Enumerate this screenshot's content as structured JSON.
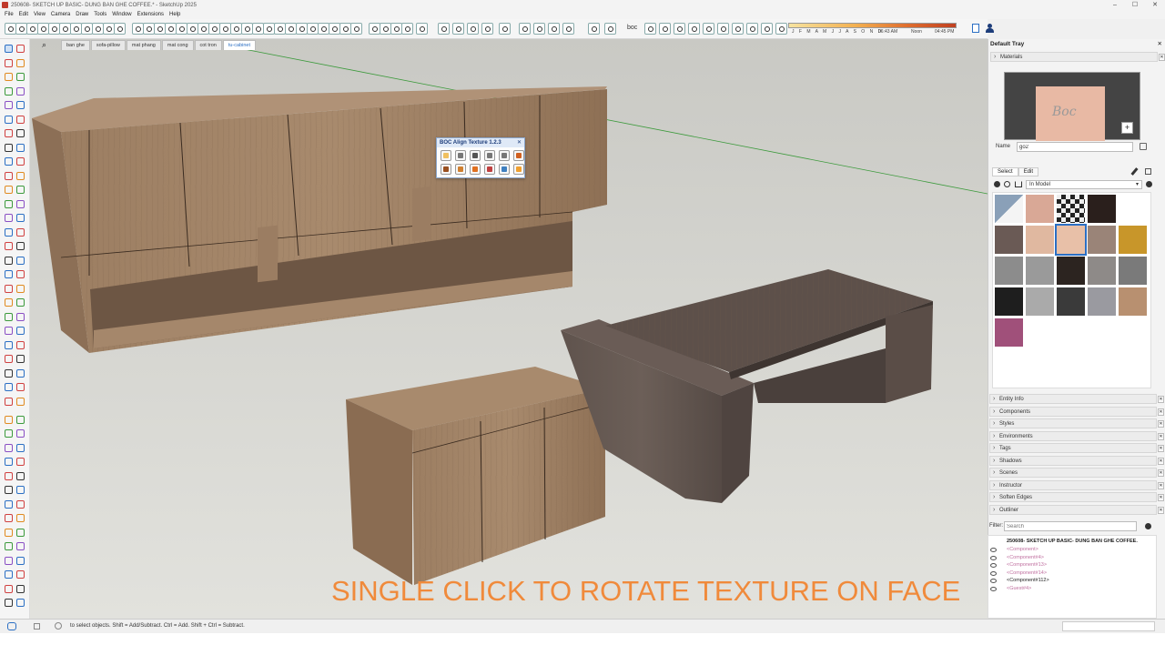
{
  "window": {
    "title": "250608- SKETCH UP BASIC- DUNG BAN GHE COFFEE.* - SketchUp 2025",
    "controls": [
      "–",
      "☐",
      "✕"
    ]
  },
  "menu": [
    "File",
    "Edit",
    "View",
    "Camera",
    "Draw",
    "Tools",
    "Window",
    "Extensions",
    "Help"
  ],
  "toolbar": {
    "boc_label": "boc",
    "shadow_months": "J F M A M J J A S O N D",
    "time_start": "06:43 AM",
    "time_mid": "Noon",
    "time_end": "04:45 PM"
  },
  "scene_tabs": [
    "ban ghe",
    "sofa-pillow",
    "mat phang",
    "mat cong",
    "cot tron",
    "tu-cabinet"
  ],
  "active_scene": "tu-cabinet",
  "overlay_caption": "SINGLE CLICK TO ROTATE TEXTURE ON FACE",
  "plugin_dialog": {
    "title": "BOC Align Texture 1.2.3",
    "close": "✕"
  },
  "tray": {
    "title": "Default Tray",
    "close": "✕",
    "materials": {
      "title": "Materials",
      "preview_text": "Boc",
      "name_label": "Name",
      "name_value": "go2",
      "tab_select": "Select",
      "tab_edit": "Edit",
      "collection": "In Model"
    },
    "panels": [
      "Entity Info",
      "Components",
      "Styles",
      "Environments",
      "Tags",
      "Shadows",
      "Scenes",
      "Instructor",
      "Soften Edges",
      "Outliner"
    ],
    "outliner": {
      "filter_label": "Filter:",
      "filter_placeholder": "Search",
      "root": "250608- SKETCH UP BASIC- DUNG BAN GHE COFFEE.",
      "rows": [
        "<Component>",
        "<Component#4>",
        "<Component#13>",
        "<Component#14>",
        "<Component#112>",
        "<Guest#4>"
      ]
    },
    "colors": {
      "accent": "#2b6fc4",
      "caption": "#f08a3b"
    }
  },
  "statusbar": {
    "message": "to select objects. Shift = Add/Subtract. Ctrl = Add. Shift + Ctrl = Subtract."
  }
}
